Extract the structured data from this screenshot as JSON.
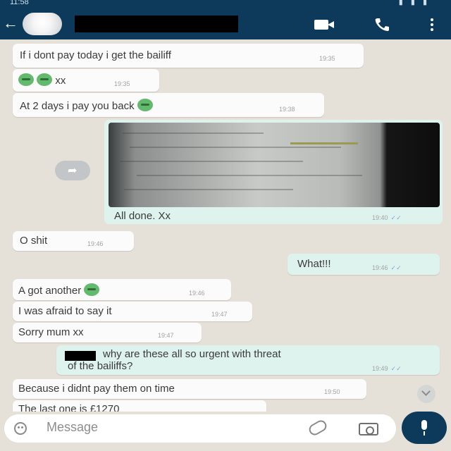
{
  "status_bar": {
    "time": "11:58"
  },
  "header": {
    "back_glyph": "←",
    "contact_avatar_icon": "avatar-icon",
    "icons": [
      "video-call-icon",
      "phone-icon",
      "more-icon"
    ]
  },
  "messages": [
    {
      "dir": "in",
      "text": "If i dont pay today i get the bailiff",
      "time": "19:35"
    },
    {
      "dir": "in",
      "text": "xx",
      "time": "19:35",
      "emoji": "sad-face-emoji"
    },
    {
      "dir": "in",
      "text": "At 2 days i pay you back",
      "time": "19:38",
      "emoji": "sad-face-emoji"
    },
    {
      "dir": "out",
      "type": "image",
      "caption": "All done. Xx",
      "time": "19:40",
      "forward_icon": "forward-icon"
    },
    {
      "dir": "in",
      "text": "O shit",
      "time": "19:46"
    },
    {
      "dir": "out",
      "text": "What!!!",
      "time": "19:46"
    },
    {
      "dir": "in",
      "text": "A got another",
      "time": "19:46",
      "emoji": "sad-face-emoji"
    },
    {
      "dir": "in",
      "text": "I was afraid to say it",
      "time": "19:47"
    },
    {
      "dir": "in",
      "text": "Sorry mum xx",
      "time": "19:47"
    },
    {
      "dir": "out",
      "text_line1": "why are these all so urgent with threat",
      "text_line2": "of the bailiffs?",
      "time": "19:49"
    },
    {
      "dir": "in",
      "text": "Because i didnt pay them on time",
      "time": "19:50"
    },
    {
      "dir": "in",
      "text": "The last one is £1270",
      "time": ""
    }
  ],
  "input": {
    "placeholder": "Message",
    "icons": [
      "emoji-icon",
      "attach-icon",
      "camera-icon",
      "mic-icon"
    ]
  },
  "colors": {
    "header": "#0d3a5a",
    "chat_bg": "#e6e1d8",
    "incoming": "#fbfbfb",
    "outgoing": "#dff3ee",
    "read_ticks": "#7fa8d8"
  }
}
